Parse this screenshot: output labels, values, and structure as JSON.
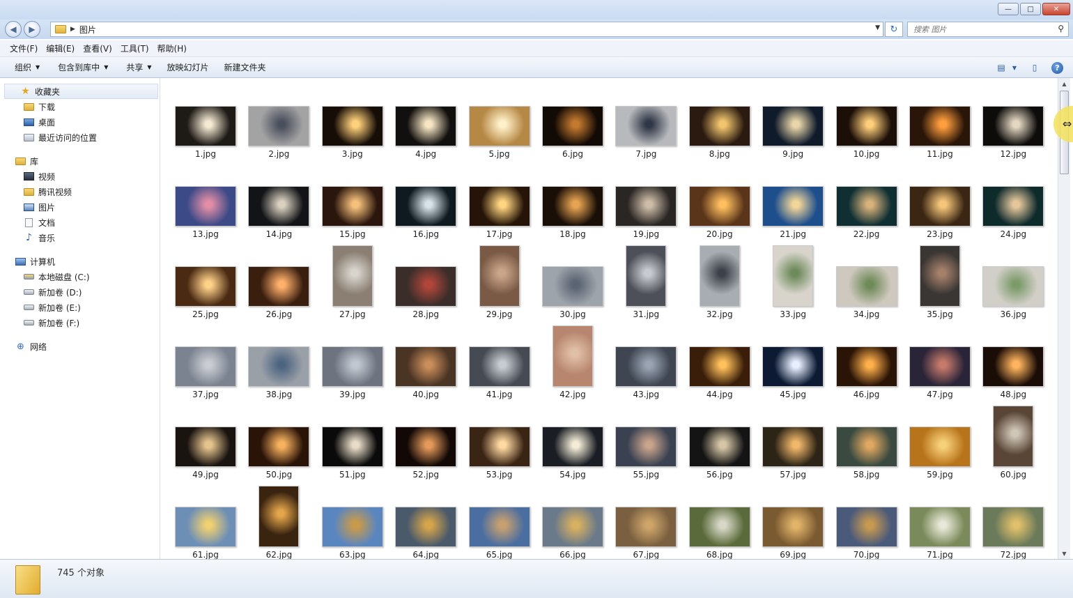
{
  "window": {
    "min_glyph": "—",
    "max_glyph": "□",
    "close_glyph": "✕"
  },
  "address": {
    "back_glyph": "◀",
    "forward_glyph": "▶",
    "breadcrumb": "图片",
    "crumb_sep": "▶",
    "dropdown_glyph": "▼",
    "refresh_glyph": "↻",
    "search_placeholder": "搜索 图片",
    "search_glyph": "⚲"
  },
  "menu": [
    "文件(F)",
    "编辑(E)",
    "查看(V)",
    "工具(T)",
    "帮助(H)"
  ],
  "toolbar": {
    "organize": "组织",
    "include_library": "包含到库中",
    "share": "共享",
    "slideshow": "放映幻灯片",
    "new_folder": "新建文件夹",
    "caret": "▼",
    "view_glyph": "▤",
    "pane_glyph": "▯",
    "help_glyph": "?"
  },
  "sidebar": {
    "favorites": {
      "label": "收藏夹",
      "items": [
        "下载",
        "桌面",
        "最近访问的位置"
      ]
    },
    "libraries": {
      "label": "库",
      "items": [
        "视频",
        "腾讯视频",
        "图片",
        "文档",
        "音乐"
      ]
    },
    "computer": {
      "label": "计算机",
      "items": [
        "本地磁盘 (C:)",
        "新加卷 (D:)",
        "新加卷 (E:)",
        "新加卷 (F:)"
      ]
    },
    "network": {
      "label": "网络"
    },
    "icons": {
      "star": "★",
      "note": "♪",
      "net": "⊕"
    }
  },
  "files": [
    {
      "name": "1.jpg",
      "bg": "#1e1a16",
      "hi": "#f4e9d2",
      "orient": "l"
    },
    {
      "name": "2.jpg",
      "bg": "#a3a3a3",
      "hi": "#4a4f5d",
      "orient": "l"
    },
    {
      "name": "3.jpg",
      "bg": "#160d07",
      "hi": "#ffd27a",
      "orient": "l"
    },
    {
      "name": "4.jpg",
      "bg": "#12100e",
      "hi": "#f7e6c4",
      "orient": "l"
    },
    {
      "name": "5.jpg",
      "bg": "#b68845",
      "hi": "#fff1c9",
      "orient": "l"
    },
    {
      "name": "6.jpg",
      "bg": "#120a05",
      "hi": "#c47a2e",
      "orient": "l"
    },
    {
      "name": "7.jpg",
      "bg": "#b7b9bc",
      "hi": "#2f3646",
      "orient": "l"
    },
    {
      "name": "8.jpg",
      "bg": "#2a1a10",
      "hi": "#f1c56d",
      "orient": "l"
    },
    {
      "name": "9.jpg",
      "bg": "#0f1a2b",
      "hi": "#e8d6a8",
      "orient": "l"
    },
    {
      "name": "10.jpg",
      "bg": "#1b0f08",
      "hi": "#ffcf7a",
      "orient": "l"
    },
    {
      "name": "11.jpg",
      "bg": "#2a1608",
      "hi": "#ff9e3d",
      "orient": "l"
    },
    {
      "name": "12.jpg",
      "bg": "#0d0c0b",
      "hi": "#e4d7c2",
      "orient": "l"
    },
    {
      "name": "13.jpg",
      "bg": "#3c4a87",
      "hi": "#e38ea6",
      "orient": "l"
    },
    {
      "name": "14.jpg",
      "bg": "#121417",
      "hi": "#d9d0c0",
      "orient": "l"
    },
    {
      "name": "15.jpg",
      "bg": "#2a160c",
      "hi": "#f5c07a",
      "orient": "l"
    },
    {
      "name": "16.jpg",
      "bg": "#0e1a20",
      "hi": "#d7e3e8",
      "orient": "l"
    },
    {
      "name": "17.jpg",
      "bg": "#251407",
      "hi": "#ffd57f",
      "orient": "l"
    },
    {
      "name": "18.jpg",
      "bg": "#1a0f07",
      "hi": "#e6a451",
      "orient": "l"
    },
    {
      "name": "19.jpg",
      "bg": "#2a2624",
      "hi": "#cdbca7",
      "orient": "l"
    },
    {
      "name": "20.jpg",
      "bg": "#5a351a",
      "hi": "#ffbf5e",
      "orient": "l"
    },
    {
      "name": "21.jpg",
      "bg": "#1e4f8d",
      "hi": "#f2d697",
      "orient": "l"
    },
    {
      "name": "22.jpg",
      "bg": "#0f2f33",
      "hi": "#d7b27a",
      "orient": "l"
    },
    {
      "name": "23.jpg",
      "bg": "#3a2612",
      "hi": "#f5c67a",
      "orient": "l"
    },
    {
      "name": "24.jpg",
      "bg": "#0e2b2c",
      "hi": "#e5c79b",
      "orient": "l"
    },
    {
      "name": "25.jpg",
      "bg": "#4a2a12",
      "hi": "#ffd28a",
      "orient": "l"
    },
    {
      "name": "26.jpg",
      "bg": "#3a1f0f",
      "hi": "#ffb06a",
      "orient": "l"
    },
    {
      "name": "27.jpg",
      "bg": "#8a7f72",
      "hi": "#d8d4ce",
      "orient": "p"
    },
    {
      "name": "28.jpg",
      "bg": "#3b2e2a",
      "hi": "#b0463a",
      "orient": "l"
    },
    {
      "name": "29.jpg",
      "bg": "#7a5a45",
      "hi": "#c9a58a",
      "orient": "p"
    },
    {
      "name": "30.jpg",
      "bg": "#9ea4ab",
      "hi": "#5a6472",
      "orient": "l"
    },
    {
      "name": "31.jpg",
      "bg": "#4d5058",
      "hi": "#c8cbd0",
      "orient": "p"
    },
    {
      "name": "32.jpg",
      "bg": "#a8adb3",
      "hi": "#3c4048",
      "orient": "p"
    },
    {
      "name": "33.jpg",
      "bg": "#d8d4cc",
      "hi": "#6d8a5a",
      "orient": "p"
    },
    {
      "name": "34.jpg",
      "bg": "#cfc8be",
      "hi": "#6e8a58",
      "orient": "l"
    },
    {
      "name": "35.jpg",
      "bg": "#3a3634",
      "hi": "#a5806a",
      "orient": "p"
    },
    {
      "name": "36.jpg",
      "bg": "#d2cfc8",
      "hi": "#7c9a6a",
      "orient": "l"
    },
    {
      "name": "37.jpg",
      "bg": "#7b8390",
      "hi": "#c9ccd2",
      "orient": "l"
    },
    {
      "name": "38.jpg",
      "bg": "#9aa0a8",
      "hi": "#4d6480",
      "orient": "l"
    },
    {
      "name": "39.jpg",
      "bg": "#6d7480",
      "hi": "#c2c7cf",
      "orient": "l"
    },
    {
      "name": "40.jpg",
      "bg": "#4a3424",
      "hi": "#c98e5a",
      "orient": "l"
    },
    {
      "name": "41.jpg",
      "bg": "#464a52",
      "hi": "#c8ccd2",
      "orient": "l"
    },
    {
      "name": "42.jpg",
      "bg": "#b8866e",
      "hi": "#e1c0a8",
      "orient": "p"
    },
    {
      "name": "43.jpg",
      "bg": "#3f4652",
      "hi": "#9aa4b2",
      "orient": "l"
    },
    {
      "name": "44.jpg",
      "bg": "#3a1e0a",
      "hi": "#ffc15a",
      "orient": "l"
    },
    {
      "name": "45.jpg",
      "bg": "#0c1a33",
      "hi": "#e8f0ff",
      "orient": "l"
    },
    {
      "name": "46.jpg",
      "bg": "#2a1406",
      "hi": "#ffb04a",
      "orient": "l"
    },
    {
      "name": "47.jpg",
      "bg": "#2a2438",
      "hi": "#c67a6a",
      "orient": "l"
    },
    {
      "name": "48.jpg",
      "bg": "#1a0c06",
      "hi": "#ffb45e",
      "orient": "l"
    },
    {
      "name": "49.jpg",
      "bg": "#1a1410",
      "hi": "#e6c48e",
      "orient": "l"
    },
    {
      "name": "50.jpg",
      "bg": "#2a1408",
      "hi": "#f7b25e",
      "orient": "l"
    },
    {
      "name": "51.jpg",
      "bg": "#0a0a0a",
      "hi": "#e8dcc8",
      "orient": "l"
    },
    {
      "name": "52.jpg",
      "bg": "#120906",
      "hi": "#e49a5a",
      "orient": "l"
    },
    {
      "name": "53.jpg",
      "bg": "#3a2414",
      "hi": "#ffd9a0",
      "orient": "l"
    },
    {
      "name": "54.jpg",
      "bg": "#1a1e24",
      "hi": "#f4ecd8",
      "orient": "l"
    },
    {
      "name": "55.jpg",
      "bg": "#3a4252",
      "hi": "#c8a48a",
      "orient": "l"
    },
    {
      "name": "56.jpg",
      "bg": "#141414",
      "hi": "#d6c6a6",
      "orient": "l"
    },
    {
      "name": "57.jpg",
      "bg": "#2c2416",
      "hi": "#f1b86a",
      "orient": "l"
    },
    {
      "name": "58.jpg",
      "bg": "#3a4a40",
      "hi": "#e0a860",
      "orient": "l"
    },
    {
      "name": "59.jpg",
      "bg": "#b8741a",
      "hi": "#f7d07a",
      "orient": "l"
    },
    {
      "name": "60.jpg",
      "bg": "#5a4636",
      "hi": "#cfc6b8",
      "orient": "p"
    },
    {
      "name": "61.jpg",
      "bg": "#6d8fb6",
      "hi": "#f0d070",
      "orient": "l"
    },
    {
      "name": "62.jpg",
      "bg": "#3a2410",
      "hi": "#e3a64a",
      "orient": "p"
    },
    {
      "name": "63.jpg",
      "bg": "#5a86c0",
      "hi": "#c89a4a",
      "orient": "l"
    },
    {
      "name": "64.jpg",
      "bg": "#4a5a6a",
      "hi": "#d6a54a",
      "orient": "l"
    },
    {
      "name": "65.jpg",
      "bg": "#4a6ea0",
      "hi": "#c8a070",
      "orient": "l"
    },
    {
      "name": "66.jpg",
      "bg": "#6a7a8a",
      "hi": "#d8b060",
      "orient": "l"
    },
    {
      "name": "67.jpg",
      "bg": "#7a6040",
      "hi": "#cfa56a",
      "orient": "l"
    },
    {
      "name": "68.jpg",
      "bg": "#5a6a3a",
      "hi": "#d8d8c8",
      "orient": "l"
    },
    {
      "name": "69.jpg",
      "bg": "#7a5a30",
      "hi": "#e2b46a",
      "orient": "l"
    },
    {
      "name": "70.jpg",
      "bg": "#4a5a7a",
      "hi": "#c89a50",
      "orient": "l"
    },
    {
      "name": "71.jpg",
      "bg": "#7a8a5a",
      "hi": "#e8e8d8",
      "orient": "l"
    },
    {
      "name": "72.jpg",
      "bg": "#6a7a5a",
      "hi": "#e0c06a",
      "orient": "l"
    }
  ],
  "status": {
    "count_text": "745 个对象"
  },
  "scroll": {
    "up_glyph": "▲",
    "down_glyph": "▼"
  }
}
